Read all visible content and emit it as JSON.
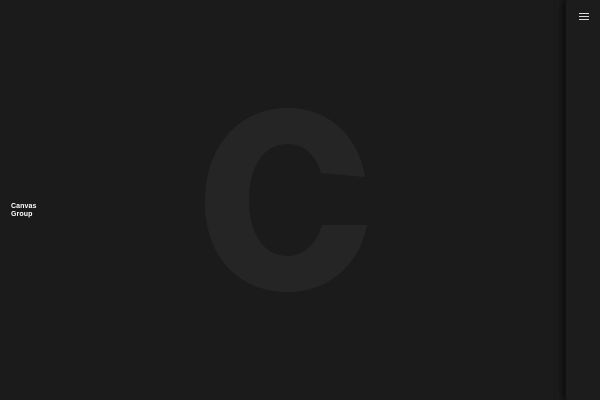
{
  "brand": {
    "line1": "Canvas",
    "line2": "Group"
  },
  "hero": {
    "watermark_letter_icon": "letter-c-logo-mark"
  },
  "side_panel": {
    "menu_icon": "hamburger-menu-icon"
  },
  "colors": {
    "background": "#1b1b1b",
    "watermark": "#252525",
    "brand_text": "#ffffff",
    "menu_icon": "#d9d9d9"
  }
}
